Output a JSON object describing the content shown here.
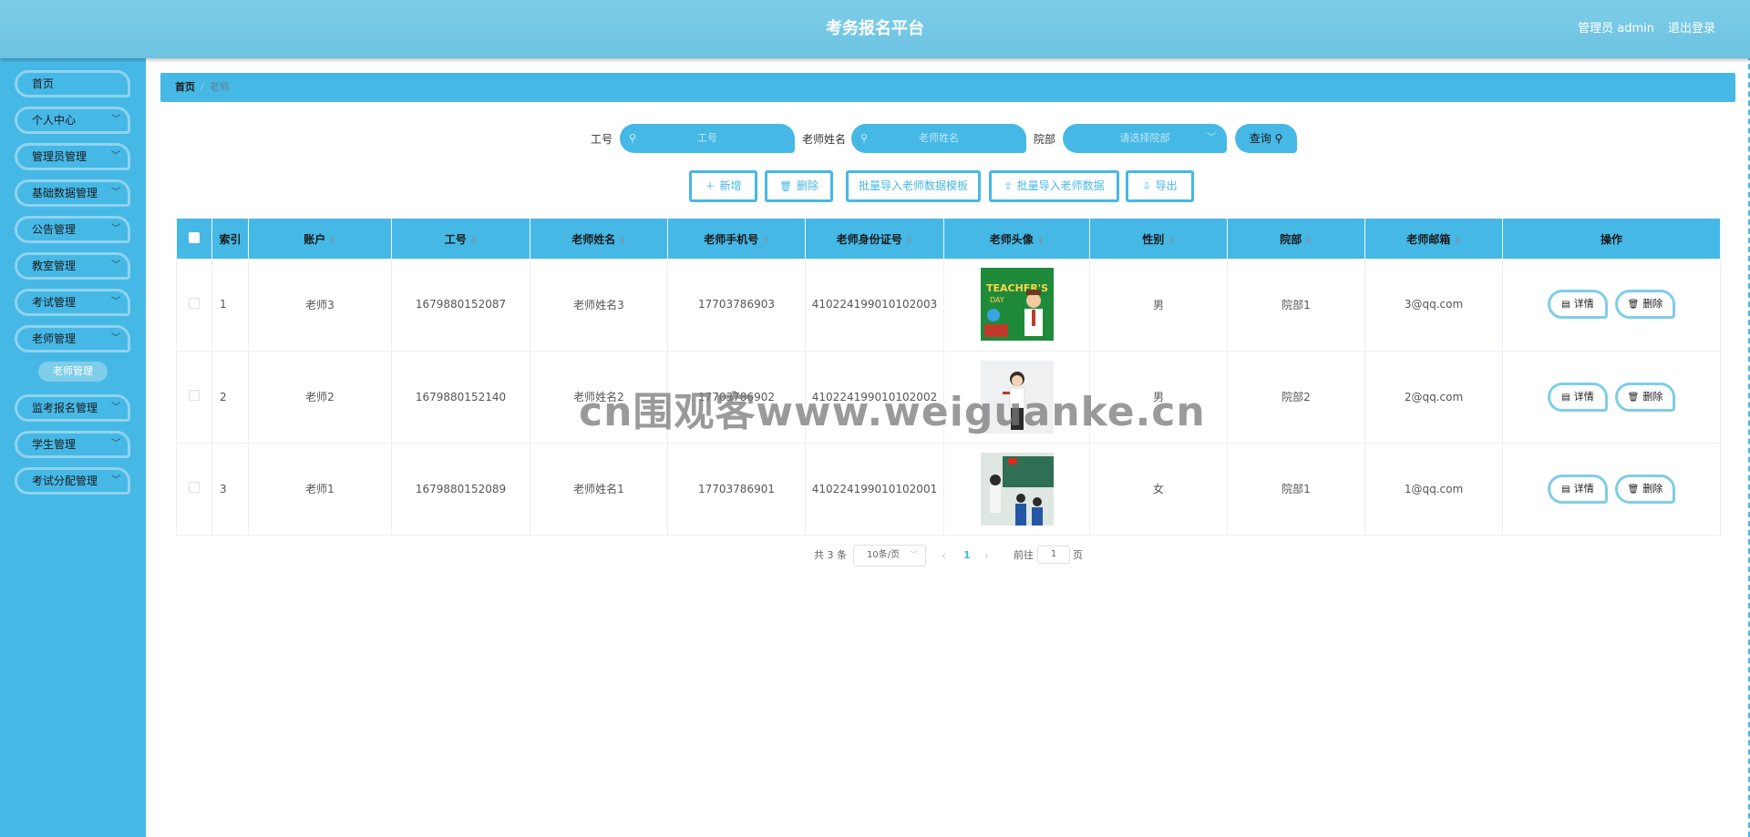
{
  "header": {
    "title": "考务报名平台",
    "user": "管理员 admin",
    "logout": "退出登录"
  },
  "sidebar": {
    "items": [
      {
        "label": "首页",
        "chevron": ""
      },
      {
        "label": "个人中心",
        "chevron": "﹀"
      },
      {
        "label": "管理员管理",
        "chevron": "﹀"
      },
      {
        "label": "基础数据管理",
        "chevron": "﹀"
      },
      {
        "label": "公告管理",
        "chevron": "﹀"
      },
      {
        "label": "教室管理",
        "chevron": "﹀"
      },
      {
        "label": "考试管理",
        "chevron": "﹀"
      },
      {
        "label": "老师管理",
        "chevron": "﹀"
      },
      {
        "label": "监考报名管理",
        "chevron": "﹀"
      },
      {
        "label": "学生管理",
        "chevron": "﹀"
      },
      {
        "label": "考试分配管理",
        "chevron": "﹀"
      }
    ],
    "sub_active": "老师管理"
  },
  "breadcrumb": {
    "home": "首页",
    "sep": "/",
    "current": "老师"
  },
  "search": {
    "id_label": "工号",
    "id_placeholder": "工号",
    "name_label": "老师姓名",
    "name_placeholder": "老师姓名",
    "dept_label": "院部",
    "dept_placeholder": "请选择院部",
    "query_label": "查询 ⚲"
  },
  "actions": {
    "add": "新增",
    "delete": "删除",
    "template": "批量导入老师数据模板",
    "import": "批量导入老师数据",
    "export": "导出"
  },
  "table": {
    "headers": [
      "索引",
      "账户",
      "工号",
      "老师姓名",
      "老师手机号",
      "老师身份证号",
      "老师头像",
      "性别",
      "院部",
      "老师邮箱",
      "操作"
    ],
    "sort_glyph": "⬍",
    "rows": [
      {
        "index": "1",
        "account": "老师3",
        "id": "1679880152087",
        "name": "老师姓名3",
        "phone": "17703786903",
        "idcard": "410224199010102003",
        "avatar": "teachers-day-illustration",
        "gender": "男",
        "dept": "院部1",
        "email": "3@qq.com"
      },
      {
        "index": "2",
        "account": "老师2",
        "id": "1679880152140",
        "name": "老师姓名2",
        "phone": "17703786902",
        "idcard": "410224199010102002",
        "avatar": "teacher-photo",
        "gender": "男",
        "dept": "院部2",
        "email": "2@qq.com"
      },
      {
        "index": "3",
        "account": "老师1",
        "id": "1679880152089",
        "name": "老师姓名1",
        "phone": "17703786901",
        "idcard": "410224199010102001",
        "avatar": "classroom-photo",
        "gender": "女",
        "dept": "院部1",
        "email": "1@qq.com"
      }
    ],
    "detail_label": "详情",
    "delete_label": "删除"
  },
  "pagination": {
    "total": "共 3 条",
    "page_size": "10条/页",
    "current": "1",
    "goto_label": "前往",
    "goto_value": "1",
    "unit": "页"
  },
  "watermark": "cn围观客www.weiguanke.cn",
  "colors": {
    "accent": "#46b8e6",
    "header": "#6bc3e2",
    "border": "#8fd3ee"
  }
}
